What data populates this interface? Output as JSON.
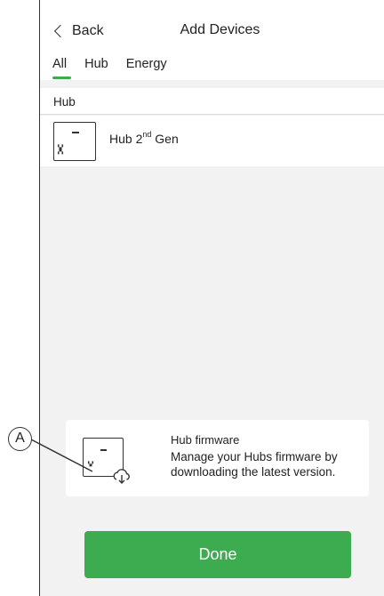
{
  "header": {
    "back_label": "Back",
    "title": "Add Devices"
  },
  "tabs": [
    {
      "label": "All",
      "active": true
    },
    {
      "label": "Hub",
      "active": false
    },
    {
      "label": "Energy",
      "active": false
    }
  ],
  "section": {
    "title": "Hub"
  },
  "devices": [
    {
      "name": "Hub 2",
      "superscript": "nd",
      "suffix": " Gen"
    }
  ],
  "firmware_card": {
    "title": "Hub firmware",
    "description": "Manage your Hubs firmware by downloading the latest version."
  },
  "callout": {
    "label": "A"
  },
  "done_button": {
    "label": "Done"
  },
  "colors": {
    "accent": "#3dab4f",
    "background": "#f2f2f3"
  }
}
